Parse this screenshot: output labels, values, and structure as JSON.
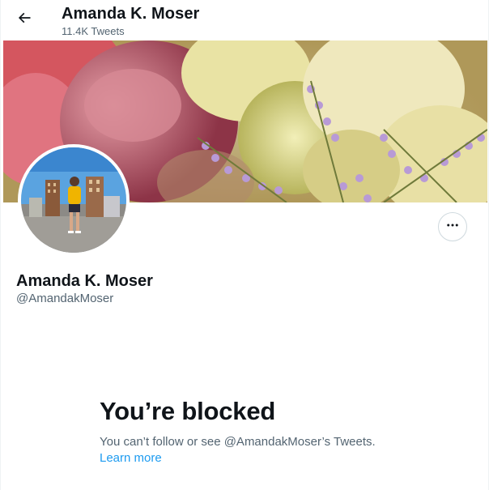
{
  "header": {
    "name": "Amanda K. Moser",
    "tweet_count": "11.4K Tweets"
  },
  "profile": {
    "name": "Amanda K. Moser",
    "handle": "@AmandakMoser"
  },
  "blocked": {
    "title": "You’re blocked",
    "description": "You can’t follow or see @AmandakMoser’s Tweets.",
    "learn_more": "Learn more"
  },
  "icons": {
    "back": "arrow-left-icon",
    "more": "more-horizontal-icon"
  },
  "colors": {
    "link": "#1d9bf0",
    "secondary_text": "#536471",
    "primary_text": "#0f1419"
  }
}
